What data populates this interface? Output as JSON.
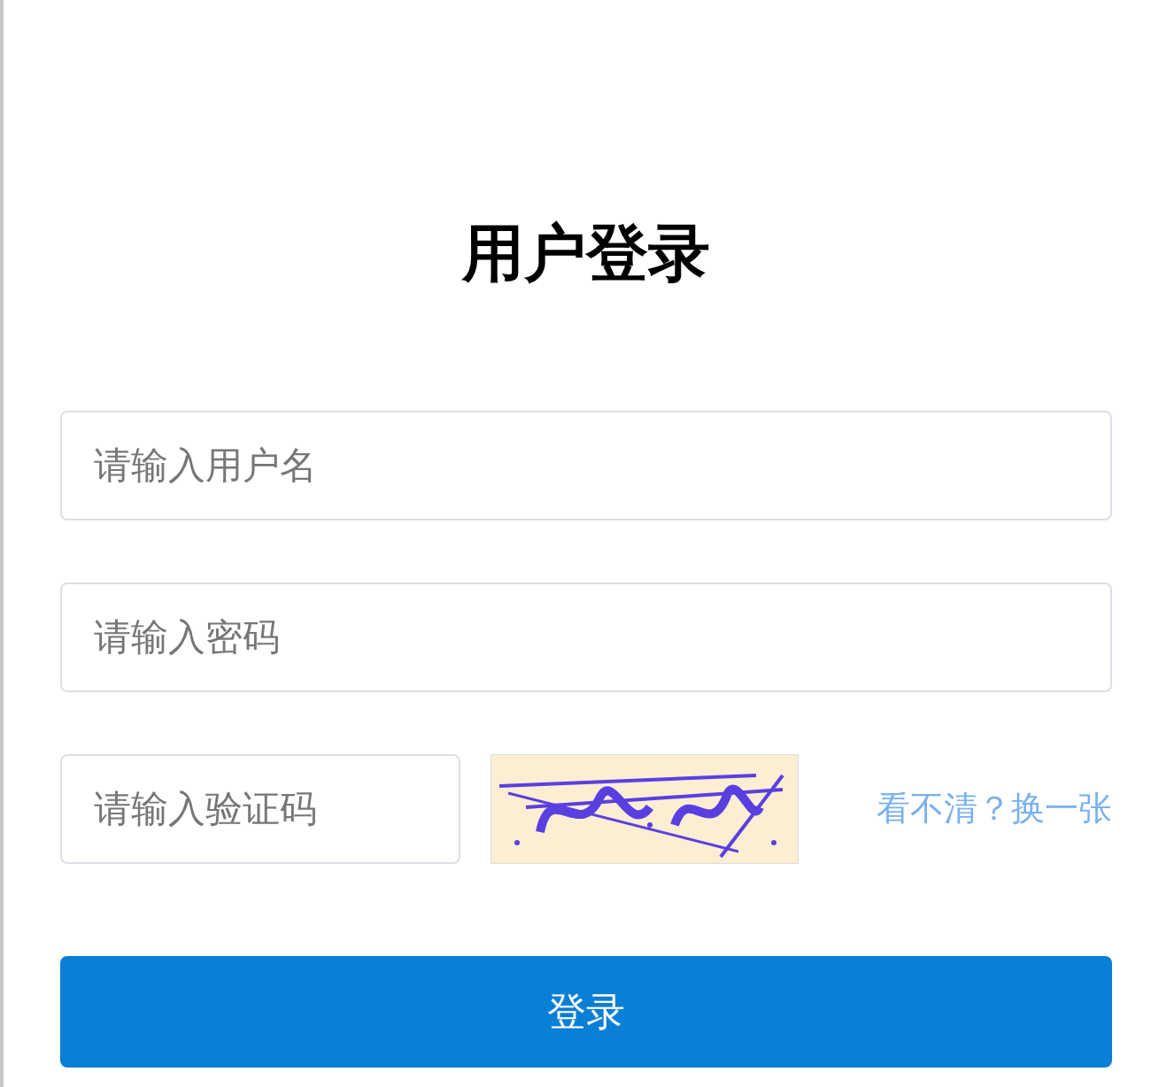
{
  "title": "用户登录",
  "fields": [
    {
      "placeholder": "请输入用户名"
    },
    {
      "placeholder": "请输入密码"
    }
  ],
  "captcha": {
    "placeholder": "请输入验证码",
    "refresh_link": "看不清？换一张"
  },
  "submit_button": "登录"
}
